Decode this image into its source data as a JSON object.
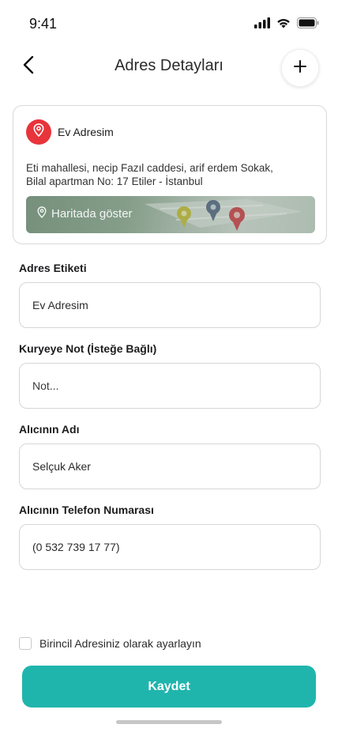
{
  "status_bar": {
    "time": "9:41"
  },
  "header": {
    "title": "Adres Detayları"
  },
  "address_card": {
    "label": "Ev Adresim",
    "address_line_1": "Eti mahallesi, necip Fazıl caddesi, arif erdem Sokak,",
    "address_line_2": "Bilal apartman No: 17 Etiler - İstanbul",
    "map_link": "Haritada göster"
  },
  "form": {
    "address_label": {
      "label": "Adres Etiketi",
      "value": "Ev Adresim"
    },
    "courier_note": {
      "label": "Kuryeye Not (İsteğe Bağlı)",
      "placeholder": "Not..."
    },
    "recipient_name": {
      "label": "Alıcının Adı",
      "value": "Selçuk Aker"
    },
    "recipient_phone": {
      "label": "Alıcının Telefon Numarası",
      "value": "(0 532 739 17 77)"
    }
  },
  "primary_checkbox": {
    "label": "Birincil Adresiniz olarak ayarlayın",
    "checked": false
  },
  "save_button": {
    "label": "Kaydet"
  },
  "colors": {
    "accent": "#1fb5ad",
    "pin": "#e8343b"
  }
}
